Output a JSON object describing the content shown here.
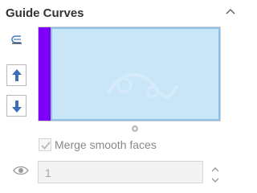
{
  "panel": {
    "title": "Guide Curves",
    "collapse_icon": "chevron-up-icon"
  },
  "toolbar": {
    "curve_select_icon": "guide-curve-icon",
    "move_up_icon": "arrow-up-icon",
    "move_down_icon": "arrow-down-icon"
  },
  "list": {
    "items": [],
    "highlight_color": "#7f00f8",
    "selection_color": "#c9e5f8"
  },
  "options": {
    "merge_smooth_faces_label": "Merge smooth faces",
    "merge_smooth_faces_checked": true
  },
  "tangency": {
    "icon": "eye-icon",
    "value": "1"
  }
}
